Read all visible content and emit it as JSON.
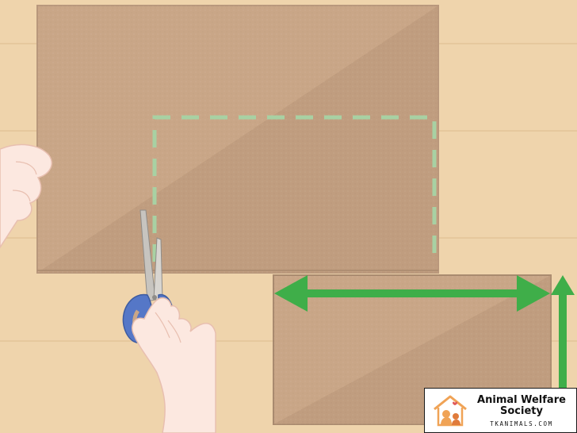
{
  "colors": {
    "background": "#efd4ac",
    "board_stripe": "#e6c89d",
    "cardboard": "#c9a687",
    "cardboard_dark": "#bb977a",
    "cut_line": "#a8d1a3",
    "arrow": "#3fae49",
    "skin": "#fce8e0",
    "scissors_handle": "#5577c7",
    "logo_orange": "#f0a356"
  },
  "icons": {
    "scissors": "scissors-icon",
    "hand": "hand-icon",
    "arrow_horizontal": "double-arrow-horizontal-icon",
    "arrow_vertical": "arrow-up-icon",
    "logo": "house-animals-logo-icon"
  },
  "watermark": {
    "title_line1": "Animal Welfare",
    "title_line2": "Society",
    "url": "TKANIMALS.COM"
  }
}
